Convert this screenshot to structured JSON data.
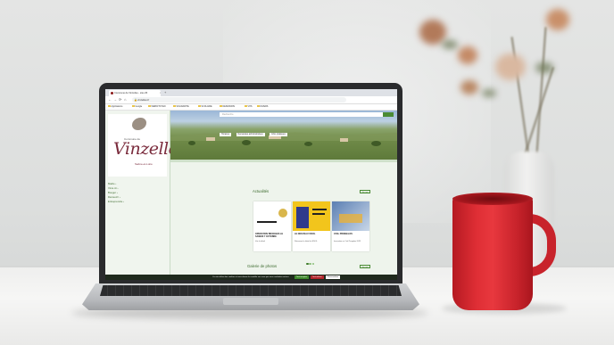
{
  "browser": {
    "tab_title": "Commune de Vinzelles - site offi",
    "tab_close": "×",
    "new_tab": "+",
    "address": "vinzelles.fr",
    "nav": {
      "back": "←",
      "forward": "→",
      "reload": "⟳",
      "home": "⌂"
    },
    "bookmarks": [
      "Applications",
      "Google",
      "WEBCITOYEN",
      "SOLIDARITE",
      "SCOLAIRE",
      "DESKPARIS",
      "VHS",
      "DIVERS"
    ]
  },
  "site": {
    "logo": {
      "small": "Commune de",
      "big": "Vinzelles",
      "sub": "Saône-et-Loire"
    },
    "side_menu": [
      "Mairie ›",
      "Vivre ici ›",
      "Bouger ›",
      "Découvrir ›",
      "Entreprendre ›"
    ],
    "search_placeholder": "Recherche",
    "hero_pills": [
      "Horaires",
      "Demandes administratives",
      "Infos pratiques"
    ],
    "news_title": "Actualités",
    "see_all": "Voir tout",
    "cards": [
      {
        "title": "OPERATION BRIOCHES LE SAMEDI 7 OCTOBRE",
        "text": "Voir le détail"
      },
      {
        "title": "LE NOUVEAU SIVOL",
        "text": "Retrouvez le détail du SIVOL"
      },
      {
        "title": "CIVIL PRINGELOS",
        "text": "Inscription au Civil Pringelos 2023"
      }
    ],
    "gallery_title": "Galerie de photos",
    "cookie_text": "Ce site utilise des cookies et vous donne le contrôle sur ceux que vous souhaitez activer",
    "cookie_accept": "Tout accepter",
    "cookie_refuse": "Tout refuser",
    "cookie_custom": "Personnaliser"
  },
  "colors": {
    "mug": "#d92a31",
    "site_green": "#3d6b2f",
    "logo_wine": "#7a2b3c"
  }
}
